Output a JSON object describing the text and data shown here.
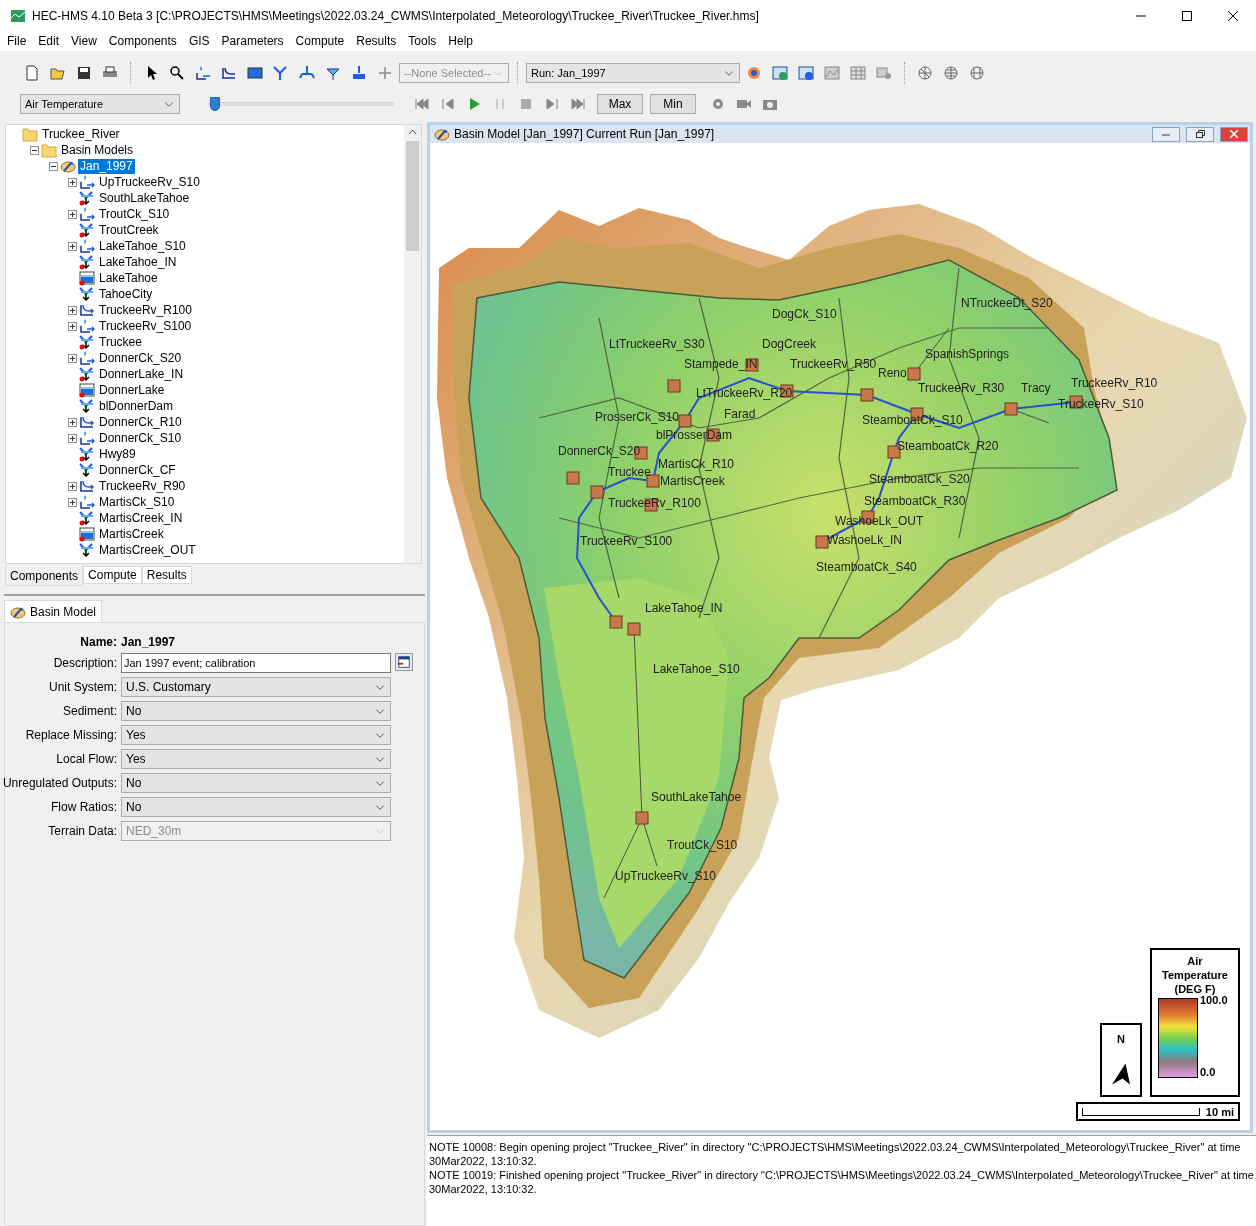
{
  "window": {
    "title": "HEC-HMS 4.10 Beta 3 [C:\\PROJECTS\\HMS\\Meetings\\2022.03.24_CWMS\\Interpolated_Meteorology\\Truckee_River\\Truckee_River.hms]"
  },
  "menu": [
    "File",
    "Edit",
    "View",
    "Components",
    "GIS",
    "Parameters",
    "Compute",
    "Results",
    "Tools",
    "Help"
  ],
  "toolbar": {
    "element_select": {
      "value": "--None Selected--",
      "disabled": true
    },
    "run_select": {
      "value": "Run: Jan_1997",
      "disabled": false
    },
    "variable_select": {
      "value": "Air Temperature",
      "disabled": false
    },
    "time_slider": {
      "level": 0.04
    },
    "buttons": [
      "Max",
      "Min"
    ]
  },
  "tree": [
    {
      "label": "Truckee_River",
      "kind": "folder",
      "selected": false,
      "children": [
        {
          "label": "Basin Models",
          "kind": "folder",
          "selected": false,
          "expanded": true,
          "children": [
            {
              "label": "Jan_1997",
              "kind": "basin",
              "selected": true,
              "expanded": true,
              "children": [
                {
                  "label": "UpTruckeeRv_S10",
                  "kind": "subbasin",
                  "selected": false,
                  "expanded": false,
                  "observed": false
                },
                {
                  "label": "SouthLakeTahoe",
                  "kind": "junction",
                  "selected": false,
                  "observed": true
                },
                {
                  "label": "TroutCk_S10",
                  "kind": "subbasin",
                  "selected": false,
                  "expanded": false,
                  "observed": false
                },
                {
                  "label": "TroutCreek",
                  "kind": "junction",
                  "selected": false,
                  "observed": true
                },
                {
                  "label": "LakeTahoe_S10",
                  "kind": "subbasin",
                  "selected": false,
                  "expanded": false,
                  "observed": false
                },
                {
                  "label": "LakeTahoe_IN",
                  "kind": "junction",
                  "selected": false,
                  "observed": true
                },
                {
                  "label": "LakeTahoe",
                  "kind": "reservoir",
                  "selected": false,
                  "observed": true
                },
                {
                  "label": "TahoeCity",
                  "kind": "junction",
                  "selected": false,
                  "observed": false
                },
                {
                  "label": "TruckeeRv_R100",
                  "kind": "reach",
                  "selected": false,
                  "expanded": false,
                  "observed": false
                },
                {
                  "label": "TruckeeRv_S100",
                  "kind": "subbasin",
                  "selected": false,
                  "expanded": false,
                  "observed": false
                },
                {
                  "label": "Truckee",
                  "kind": "junction",
                  "selected": false,
                  "observed": true
                },
                {
                  "label": "DonnerCk_S20",
                  "kind": "subbasin",
                  "selected": false,
                  "expanded": false,
                  "observed": false
                },
                {
                  "label": "DonnerLake_IN",
                  "kind": "junction",
                  "selected": false,
                  "observed": true
                },
                {
                  "label": "DonnerLake",
                  "kind": "reservoir",
                  "selected": false,
                  "observed": true
                },
                {
                  "label": "blDonnerDam",
                  "kind": "junction",
                  "selected": false,
                  "observed": false
                },
                {
                  "label": "DonnerCk_R10",
                  "kind": "reach",
                  "selected": false,
                  "expanded": false,
                  "observed": false
                },
                {
                  "label": "DonnerCk_S10",
                  "kind": "subbasin",
                  "selected": false,
                  "expanded": false,
                  "observed": false
                },
                {
                  "label": "Hwy89",
                  "kind": "junction",
                  "selected": false,
                  "observed": true
                },
                {
                  "label": "DonnerCk_CF",
                  "kind": "junction",
                  "selected": false,
                  "observed": false
                },
                {
                  "label": "TruckeeRv_R90",
                  "kind": "reach",
                  "selected": false,
                  "expanded": false,
                  "observed": false
                },
                {
                  "label": "MartisCk_S10",
                  "kind": "subbasin",
                  "selected": false,
                  "expanded": false,
                  "observed": false
                },
                {
                  "label": "MartisCreek_IN",
                  "kind": "junction",
                  "selected": false,
                  "observed": true
                },
                {
                  "label": "MartisCreek",
                  "kind": "reservoir",
                  "selected": false,
                  "observed": true
                },
                {
                  "label": "MartisCreek_OUT",
                  "kind": "junction",
                  "selected": false,
                  "observed": false
                }
              ]
            }
          ]
        }
      ]
    }
  ],
  "explorer_tabs": [
    {
      "label": "Components",
      "selected": true
    },
    {
      "label": "Compute",
      "selected": false
    },
    {
      "label": "Results",
      "selected": false
    }
  ],
  "properties": {
    "tab": {
      "label": "Basin Model",
      "selected": true
    },
    "name_label": "Name:",
    "name_value": "Jan_1997",
    "fields": [
      {
        "label": "Description:",
        "kind": "text",
        "value": "Jan 1997 event; calibration",
        "disabled": false
      },
      {
        "label": "Unit System:",
        "kind": "select",
        "value": "U.S. Customary",
        "disabled": false
      },
      {
        "label": "Sediment:",
        "kind": "select",
        "value": "No",
        "disabled": false
      },
      {
        "label": "Replace Missing:",
        "kind": "select",
        "value": "Yes",
        "disabled": false
      },
      {
        "label": "Local Flow:",
        "kind": "select",
        "value": "Yes",
        "disabled": false
      },
      {
        "label": "Unregulated Outputs:",
        "kind": "select",
        "value": "No",
        "disabled": false
      },
      {
        "label": "Flow Ratios:",
        "kind": "select",
        "value": "No",
        "disabled": false
      },
      {
        "label": "Terrain Data:",
        "kind": "select",
        "value": "NED_30m",
        "disabled": true
      }
    ]
  },
  "map_window": {
    "title": "Basin Model [Jan_1997] Current Run [Jan_1997]",
    "labels": [
      "DogCk_S10",
      "NTruckeeDt_S20",
      "LtTruckeeRv_S30",
      "DogCreek",
      "Stampede_IN",
      "TruckeeRv_R50",
      "SpanishSprings",
      "Reno",
      "TruckeeRv_R10",
      "LtTruckeeRv_R20",
      "TruckeeRv_R30",
      "Tracy",
      "TruckeeRv_S10",
      "Farad",
      "ProsserCk_S10",
      "SteamboatCk_S10",
      "blProsserDam",
      "SteamboatCk_R20",
      "DonnerCk_S20",
      "MartisCk_R10",
      "Truckee",
      "MartisCreek",
      "SteamboatCk_S20",
      "TruckeeRv_R100",
      "SteamboatCk_R30",
      "WashoeLk_OUT",
      "TruckeeRv_S100",
      "WashoeLk_IN",
      "SteamboatCk_S40",
      "LakeTahoe_IN",
      "LakeTahoe_S10",
      "SouthLakeTahoe",
      "TroutCk_S10",
      "UpTruckeeRv_S10"
    ],
    "north_label": "N",
    "legend": {
      "title": "Air Temperature (DEG F)",
      "max": "100.0",
      "min": "0.0"
    },
    "scale_label": "10 mi"
  },
  "log": [
    "NOTE 10008:  Begin opening project \"Truckee_River\" in directory \"C:\\PROJECTS\\HMS\\Meetings\\2022.03.24_CWMS\\Interpolated_Meteorology\\Truckee_River\" at time 30Mar2022, 13:10:32.",
    "NOTE 10019:  Finished opening project \"Truckee_River\" in directory \"C:\\PROJECTS\\HMS\\Meetings\\2022.03.24_CWMS\\Interpolated_Meteorology\\Truckee_River\" at time 30Mar2022, 13:10:32."
  ]
}
